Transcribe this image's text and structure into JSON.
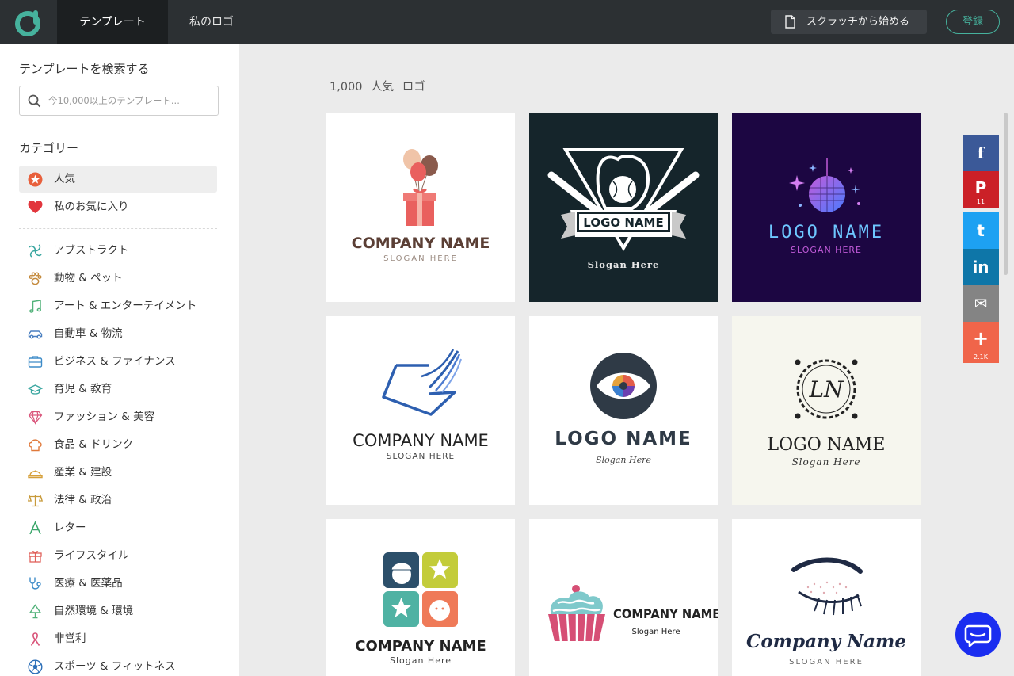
{
  "nav": {
    "tabs": [
      {
        "label": "テンプレート",
        "active": true
      },
      {
        "label": "私のロゴ",
        "active": false
      }
    ],
    "start_from_scratch": "スクラッチから始める",
    "login": "登録",
    "brand_icon": "brand-logo-icon",
    "accent_color": "#46b29d"
  },
  "sidebar": {
    "search_title": "テンプレートを検索する",
    "search_placeholder": "今10,000以上のテンプレート...",
    "categories_title": "カテゴリー",
    "items": [
      {
        "label": "人気",
        "icon": "star-icon",
        "active": true
      },
      {
        "label": "私のお気に入り",
        "icon": "heart-icon"
      },
      {
        "label": "アブストラクト",
        "icon": "abstract-icon"
      },
      {
        "label": "動物 & ペット",
        "icon": "paw-icon"
      },
      {
        "label": "アート & エンターテイメント",
        "icon": "music-note-icon"
      },
      {
        "label": "自動車 & 物流",
        "icon": "car-icon"
      },
      {
        "label": "ビジネス & ファイナンス",
        "icon": "briefcase-icon"
      },
      {
        "label": "育児 & 教育",
        "icon": "graduation-cap-icon"
      },
      {
        "label": "ファッション & 美容",
        "icon": "diamond-icon"
      },
      {
        "label": "食品 & ドリンク",
        "icon": "chef-hat-icon"
      },
      {
        "label": "産業 & 建設",
        "icon": "hard-hat-icon"
      },
      {
        "label": "法律 & 政治",
        "icon": "scales-icon"
      },
      {
        "label": "レター",
        "icon": "letter-a-icon"
      },
      {
        "label": "ライフスタイル",
        "icon": "gift-icon"
      },
      {
        "label": "医療 & 医薬品",
        "icon": "stethoscope-icon"
      },
      {
        "label": "自然環境 & 環境",
        "icon": "tree-icon"
      },
      {
        "label": "非営利",
        "icon": "ribbon-icon"
      },
      {
        "label": "スポーツ & フィットネス",
        "icon": "soccer-ball-icon"
      }
    ]
  },
  "main": {
    "result_count": "1,000",
    "result_label": "人気",
    "result_suffix": "ロゴ",
    "cards": [
      {
        "name": "COMPANY NAME",
        "slogan": "SLOGAN HERE",
        "bg": "#ffffff"
      },
      {
        "name": "LOGO NAME",
        "slogan": "Slogan Here",
        "bg": "#15252b"
      },
      {
        "name": "LOGO NAME",
        "slogan": "SLOGAN HERE",
        "bg": "#1c0642"
      },
      {
        "name": "COMPANY NAME",
        "slogan": "SLOGAN HERE",
        "bg": "#ffffff"
      },
      {
        "name": "LOGO NAME",
        "slogan": "Slogan Here",
        "bg": "#ffffff"
      },
      {
        "name": "LOGO NAME",
        "slogan": "Slogan Here",
        "bg": "#f6f6ee",
        "monogram": "LN"
      },
      {
        "name": "COMPANY NAME",
        "slogan": "Slogan Here",
        "bg": "#ffffff"
      },
      {
        "name": "COMPANY NAME",
        "slogan": "Slogan Here",
        "bg": "#ffffff"
      },
      {
        "name": "Company Name",
        "slogan": "SLOGAN HERE",
        "bg": "#ffffff"
      }
    ]
  },
  "share": [
    {
      "network": "facebook",
      "glyph": "f",
      "color": "#3b5998",
      "count": ""
    },
    {
      "network": "pinterest",
      "glyph": "P",
      "color": "#cb2027",
      "count": "11"
    },
    {
      "network": "twitter",
      "glyph": "t",
      "color": "#1da1f2",
      "count": ""
    },
    {
      "network": "linkedin",
      "glyph": "in",
      "color": "#0e76a8",
      "count": ""
    },
    {
      "network": "email",
      "glyph": "✉",
      "color": "#848484",
      "count": ""
    },
    {
      "network": "more",
      "glyph": "+",
      "color": "#f0654a",
      "count": "2.1K"
    }
  ],
  "chat": {
    "icon": "chat-bubble-icon",
    "color": "#1a2df0"
  }
}
